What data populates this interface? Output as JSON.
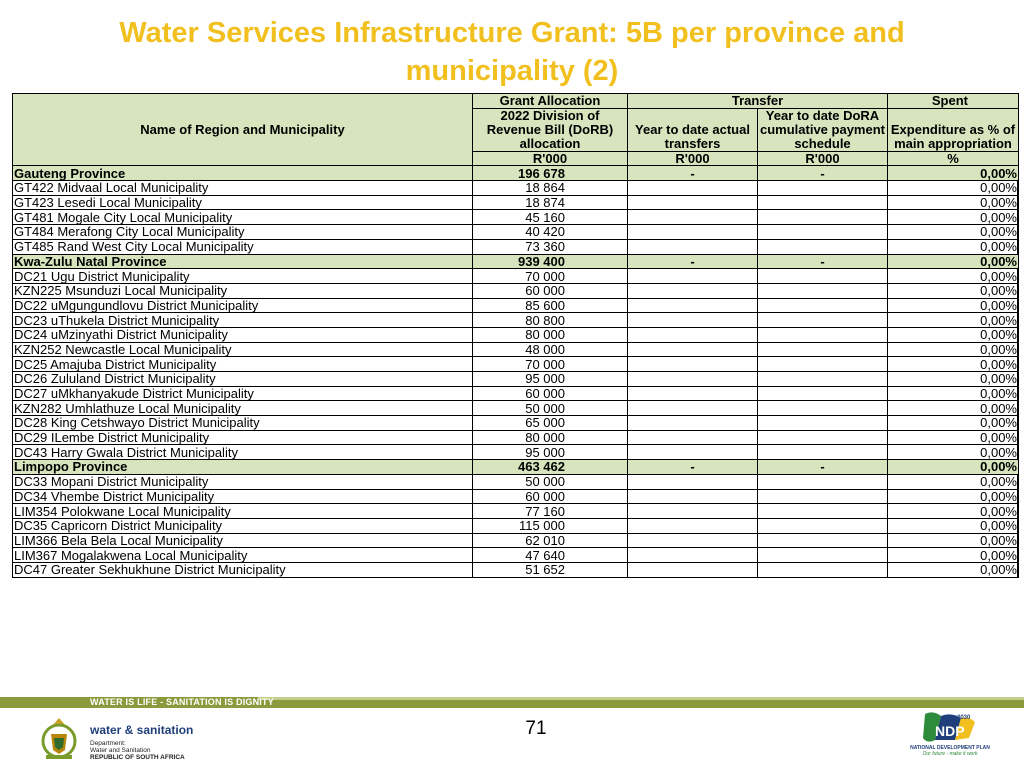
{
  "title": "Water Services Infrastructure Grant: 5B per province and municipality (2)",
  "table": {
    "headers": {
      "name": "Name of Region and Municipality",
      "grant_allocation": "Grant Allocation",
      "transfer": "Transfer",
      "spent": "Spent",
      "dorb": "2022 Division of Revenue Bill (DoRB) allocation",
      "ytd_actual": "Year to date actual transfers",
      "ytd_dora": "Year to date DoRA cumulative payment schedule",
      "expenditure": "Expenditure as % of main appropriation",
      "unit_rand": "R'000",
      "unit_pct": "%"
    },
    "rows": [
      {
        "name": "Gauteng Province",
        "alloc": "196 678",
        "actual": "-",
        "dora": "-",
        "pct": "0,00%",
        "province": true
      },
      {
        "name": "GT422 Midvaal Local Municipality",
        "alloc": "18 864",
        "actual": "",
        "dora": "",
        "pct": "0,00%"
      },
      {
        "name": "GT423 Lesedi Local Municipality",
        "alloc": "18 874",
        "actual": "",
        "dora": "",
        "pct": "0,00%"
      },
      {
        "name": "GT481 Mogale City Local Municipality",
        "alloc": "45 160",
        "actual": "",
        "dora": "",
        "pct": "0,00%"
      },
      {
        "name": "GT484 Merafong City Local Municipality",
        "alloc": "40 420",
        "actual": "",
        "dora": "",
        "pct": "0,00%"
      },
      {
        "name": "GT485 Rand West City Local Municipality",
        "alloc": "73 360",
        "actual": "",
        "dora": "",
        "pct": "0,00%"
      },
      {
        "name": "Kwa-Zulu Natal Province",
        "alloc": "939 400",
        "actual": "-",
        "dora": "-",
        "pct": "0,00%",
        "province": true
      },
      {
        "name": "DC21 Ugu District Municipality",
        "alloc": "70 000",
        "actual": "",
        "dora": "",
        "pct": "0,00%"
      },
      {
        "name": "KZN225 Msunduzi Local Municipality",
        "alloc": "60 000",
        "actual": "",
        "dora": "",
        "pct": "0,00%"
      },
      {
        "name": "DC22 uMgungundlovu District Municipality",
        "alloc": "85 600",
        "actual": "",
        "dora": "",
        "pct": "0,00%"
      },
      {
        "name": "DC23 uThukela District Municipality",
        "alloc": "80 800",
        "actual": "",
        "dora": "",
        "pct": "0,00%"
      },
      {
        "name": "DC24 uMzinyathi District Municipality",
        "alloc": "80 000",
        "actual": "",
        "dora": "",
        "pct": "0,00%"
      },
      {
        "name": "KZN252 Newcastle Local Municipality",
        "alloc": "48 000",
        "actual": "",
        "dora": "",
        "pct": "0,00%"
      },
      {
        "name": "DC25 Amajuba District Municipality",
        "alloc": "70 000",
        "actual": "",
        "dora": "",
        "pct": "0,00%"
      },
      {
        "name": "DC26 Zululand District Municipality",
        "alloc": "95 000",
        "actual": "",
        "dora": "",
        "pct": "0,00%"
      },
      {
        "name": "DC27 uMkhanyakude District Municipality",
        "alloc": "60 000",
        "actual": "",
        "dora": "",
        "pct": "0,00%"
      },
      {
        "name": "KZN282 Umhlathuze Local Municipality",
        "alloc": "50 000",
        "actual": "",
        "dora": "",
        "pct": "0,00%"
      },
      {
        "name": "DC28 King Cetshwayo District Municipality",
        "alloc": "65 000",
        "actual": "",
        "dora": "",
        "pct": "0,00%"
      },
      {
        "name": "DC29 ILembe District Municipality",
        "alloc": "80 000",
        "actual": "",
        "dora": "",
        "pct": "0,00%"
      },
      {
        "name": "DC43 Harry Gwala District Municipality",
        "alloc": "95 000",
        "actual": "",
        "dora": "",
        "pct": "0,00%"
      },
      {
        "name": "Limpopo Province",
        "alloc": "463 462",
        "actual": "-",
        "dora": "-",
        "pct": "0,00%",
        "province": true
      },
      {
        "name": "DC33 Mopani District Municipality",
        "alloc": "50 000",
        "actual": "",
        "dora": "",
        "pct": "0,00%"
      },
      {
        "name": "DC34 Vhembe District Municipality",
        "alloc": "60 000",
        "actual": "",
        "dora": "",
        "pct": "0,00%"
      },
      {
        "name": "LIM354 Polokwane Local Municipality",
        "alloc": "77 160",
        "actual": "",
        "dora": "",
        "pct": "0,00%"
      },
      {
        "name": "DC35 Capricorn District Municipality",
        "alloc": "115 000",
        "actual": "",
        "dora": "",
        "pct": "0,00%"
      },
      {
        "name": "LIM366 Bela Bela Local Municipality",
        "alloc": "62 010",
        "actual": "",
        "dora": "",
        "pct": "0,00%"
      },
      {
        "name": "LIM367 Mogalakwena Local Municipality",
        "alloc": "47 640",
        "actual": "",
        "dora": "",
        "pct": "0,00%"
      },
      {
        "name": "DC47 Greater Sekhukhune District Municipality",
        "alloc": "51 652",
        "actual": "",
        "dora": "",
        "pct": "0,00%"
      }
    ]
  },
  "footer": {
    "banner": "WATER IS LIFE - SANITATION IS DIGNITY",
    "page_number": "71",
    "dept_title": "water & sanitation",
    "dept_line1": "Department:",
    "dept_line2": "Water and Sanitation",
    "dept_line3": "REPUBLIC OF SOUTH AFRICA",
    "ndp_year": "2030",
    "ndp_abbr": "NDP",
    "ndp_name": "NATIONAL DEVELOPMENT PLAN",
    "ndp_tagline": "Our future - make it work"
  },
  "colors": {
    "title": "#f2c01e",
    "header_fill": "#d7e4bd",
    "footer_bar": "#8b9a3c"
  }
}
